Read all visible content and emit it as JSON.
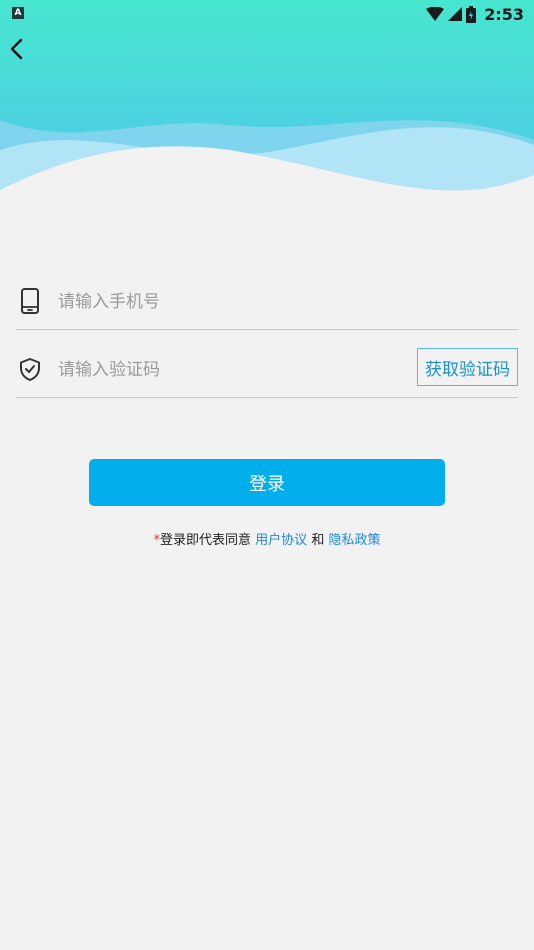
{
  "status_bar": {
    "time": "2:53",
    "app_badge": "A"
  },
  "header": {
    "back_icon": "chevron-left-icon"
  },
  "form": {
    "phone_placeholder": "请输入手机号",
    "code_placeholder": "请输入验证码",
    "get_code_label": "获取验证码",
    "login_label": "登录"
  },
  "agreement": {
    "star": "*",
    "prefix": "登录即代表同意",
    "user_agreement": "用户协议",
    "and": "和",
    "privacy_policy": "隐私政策"
  },
  "colors": {
    "accent": "#00aeec",
    "link": "#1e88e5",
    "header_top": "#47e6cf",
    "header_bottom": "#4cc7e8",
    "background": "#f2f2f2"
  }
}
